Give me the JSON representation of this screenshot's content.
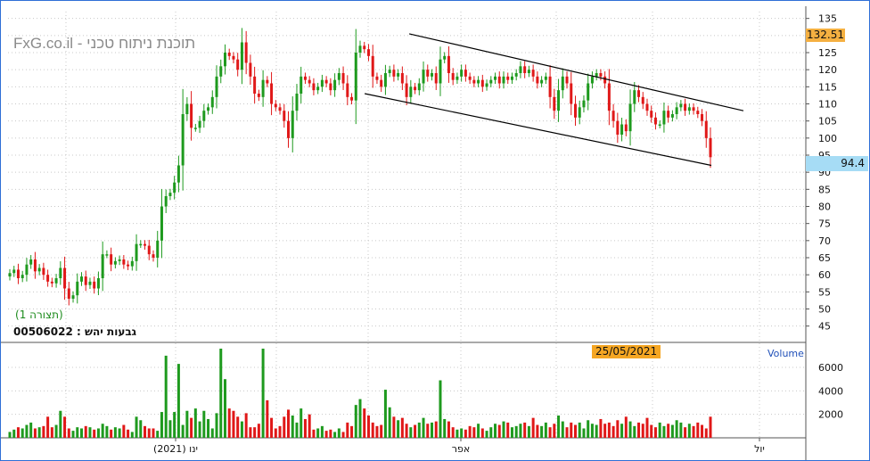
{
  "watermark": "FxG.co.il - תוכנת ניתוח טכני",
  "pane_label": "(תצורה 1)",
  "ticker_line": "00506022 : גבעות יהש",
  "cursor_date": "25/05/2021",
  "volume_label": "Volume",
  "high_value": "132.51",
  "last_value": "94.4",
  "colors": {
    "up": "#1e9a1e",
    "down": "#e01818",
    "grid": "#c8c8c8",
    "frame": "#2f6fd6",
    "high_badge": "#f5b041",
    "last_badge": "#a6dcf5",
    "date_badge": "#f5a623"
  },
  "chart_data": [
    {
      "type": "candlestick",
      "yticks": [
        45,
        50,
        55,
        60,
        65,
        70,
        75,
        80,
        85,
        90,
        95,
        100,
        105,
        110,
        115,
        120,
        125,
        130,
        135
      ],
      "ylim": [
        41,
        137
      ],
      "xticks": [
        "ינו (2021)",
        "אפר",
        "יול"
      ],
      "close": [
        60.5,
        61.5,
        59,
        60,
        63,
        64.5,
        61,
        62,
        60,
        58,
        57.5,
        59,
        62,
        56,
        53,
        54,
        58,
        59.5,
        57,
        58,
        56,
        59,
        66,
        66,
        63,
        64,
        64.5,
        63,
        62.5,
        64,
        69,
        69,
        68.5,
        66,
        65,
        70,
        80,
        83,
        84,
        87,
        92,
        107,
        110,
        103,
        103,
        105,
        108,
        109,
        112,
        118,
        121,
        125,
        124,
        123,
        120,
        128,
        122,
        118,
        113,
        112,
        117,
        116,
        110,
        109,
        108,
        105,
        100,
        108,
        113,
        118,
        117,
        116,
        114,
        115,
        117,
        116,
        114,
        117,
        119,
        116,
        112,
        111,
        125,
        127,
        126,
        124,
        118,
        117,
        115,
        119,
        120,
        118,
        119,
        116,
        112,
        115,
        114,
        116,
        120,
        118,
        119,
        116,
        123,
        124,
        119,
        117,
        118,
        120,
        118,
        117,
        116,
        117,
        115,
        116,
        117,
        118,
        116,
        118,
        117,
        118,
        119,
        121,
        119,
        120,
        118,
        116,
        117,
        118,
        112,
        108,
        114,
        118,
        116,
        110,
        106,
        109,
        111,
        116,
        118,
        119,
        118,
        116,
        108,
        105,
        101,
        104,
        102,
        110,
        114,
        112,
        110,
        108,
        106,
        104,
        104,
        108,
        106,
        107,
        109,
        110,
        108,
        109,
        108,
        107,
        105,
        100,
        94.4
      ],
      "high_marker": 132.51,
      "last": 94.4,
      "channel_upper": [
        [
          130.5,
          0
        ],
        [
          108,
          1
        ]
      ],
      "channel_lower": [
        [
          113,
          0
        ],
        [
          92,
          1
        ]
      ]
    },
    {
      "type": "bar",
      "name": "Volume",
      "yticks": [
        2000,
        4000,
        6000
      ],
      "ylim": [
        0,
        7600
      ],
      "values": [
        500,
        700,
        900,
        800,
        1100,
        1300,
        800,
        900,
        1000,
        1800,
        900,
        1100,
        2300,
        1800,
        800,
        600,
        900,
        800,
        1000,
        900,
        700,
        800,
        1200,
        1000,
        700,
        900,
        800,
        1100,
        700,
        500,
        1800,
        1500,
        1000,
        800,
        800,
        600,
        2200,
        7000,
        1500,
        2200,
        6300,
        1100,
        2300,
        1700,
        2500,
        1400,
        2300,
        1600,
        800,
        2100,
        7600,
        5000,
        2500,
        2300,
        1800,
        1400,
        2100,
        900,
        900,
        1200,
        7600,
        3200,
        1700,
        800,
        1000,
        1800,
        2400,
        1900,
        1300,
        2500,
        1600,
        2000,
        700,
        800,
        1000,
        600,
        700,
        500,
        800,
        500,
        1300,
        1000,
        2800,
        3300,
        2500,
        1900,
        1300,
        1000,
        1100,
        4100,
        2600,
        1800,
        1500,
        1700,
        1200,
        900,
        1100,
        1300,
        1700,
        1200,
        1300,
        1400,
        4900,
        1600,
        1400,
        900,
        700,
        800,
        700,
        1000,
        900,
        1200,
        800,
        600,
        900,
        1200,
        1100,
        1400,
        1300,
        900,
        1000,
        1200,
        1300,
        1000,
        1700,
        1100,
        1000,
        1300,
        900,
        1200,
        1900,
        1400,
        900,
        1300,
        1100,
        1300,
        800,
        1500,
        1200,
        1100,
        1600,
        1200,
        1300,
        1000,
        1500,
        1200,
        1800,
        1400,
        1000,
        1300,
        1200,
        1700,
        1100,
        900,
        1300,
        1000,
        1200,
        1100,
        1500,
        1300,
        900,
        1200,
        1000,
        1300,
        1100,
        800,
        1800
      ]
    }
  ]
}
